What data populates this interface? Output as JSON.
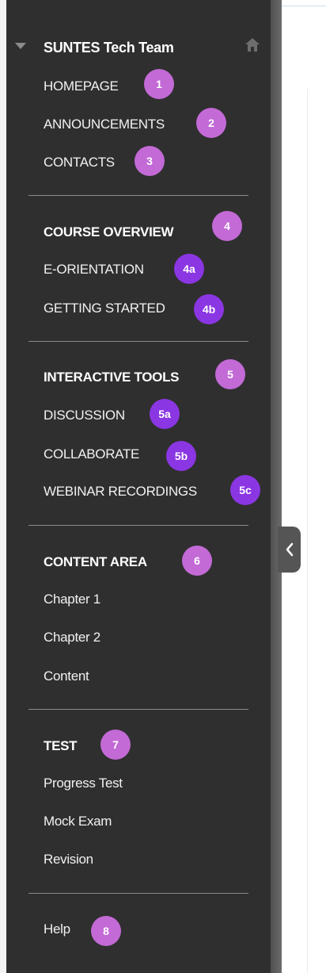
{
  "course": {
    "title": "SUNTES Tech Team"
  },
  "sections": [
    {
      "items": [
        {
          "label": "HOMEPAGE",
          "badge": "1"
        },
        {
          "label": "ANNOUNCEMENTS",
          "badge": "2"
        },
        {
          "label": "CONTACTS",
          "badge": "3"
        }
      ]
    },
    {
      "header": {
        "label": "COURSE OVERVIEW",
        "badge": "4"
      },
      "items": [
        {
          "label": "E-ORIENTATION",
          "badge": "4a"
        },
        {
          "label": "GETTING STARTED",
          "badge": "4b"
        }
      ]
    },
    {
      "header": {
        "label": "INTERACTIVE TOOLS",
        "badge": "5"
      },
      "items": [
        {
          "label": "DISCUSSION",
          "badge": "5a"
        },
        {
          "label": "COLLABORATE",
          "badge": "5b"
        },
        {
          "label": "WEBINAR RECORDINGS",
          "badge": "5c"
        }
      ]
    },
    {
      "header": {
        "label": "CONTENT AREA",
        "badge": "6"
      },
      "items": [
        {
          "label": "Chapter 1"
        },
        {
          "label": "Chapter 2"
        },
        {
          "label": "Content"
        }
      ]
    },
    {
      "header": {
        "label": "TEST",
        "badge": "7"
      },
      "items": [
        {
          "label": "Progress Test"
        },
        {
          "label": "Mock Exam"
        },
        {
          "label": "Revision"
        }
      ]
    },
    {
      "items": [
        {
          "label": "Help",
          "badge": "8"
        }
      ]
    }
  ],
  "icons": {
    "collapse": "triangle-down-icon",
    "home": "home-icon",
    "toggle": "chevron-left-icon"
  },
  "colors": {
    "sidebar_bg": "#2f2f2f",
    "badge_pink": "#c36ad6",
    "badge_purple": "#8b36e3"
  }
}
